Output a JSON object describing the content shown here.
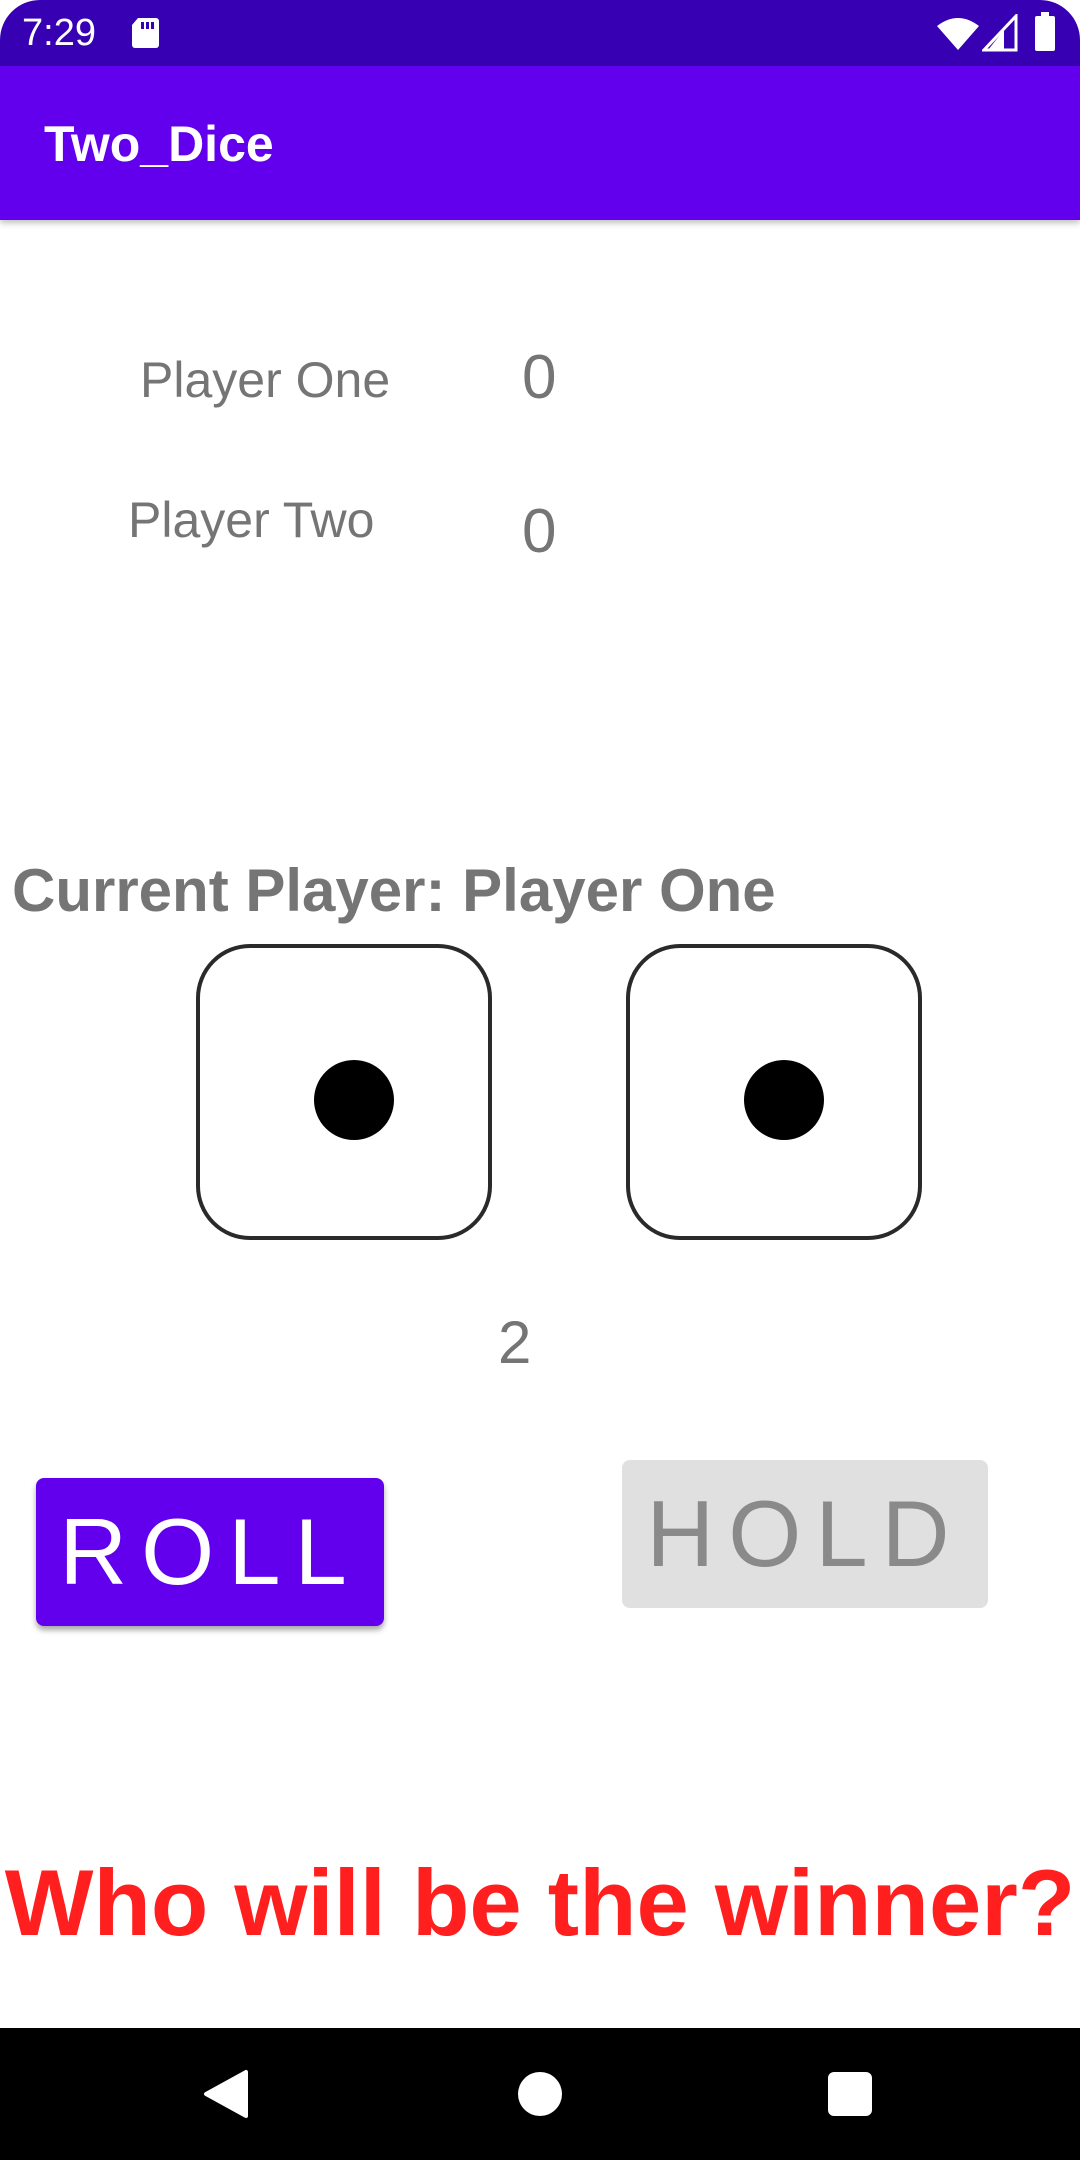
{
  "status_bar": {
    "time": "7:29",
    "icons": [
      "sd-card-icon",
      "wifi-icon",
      "signal-icon",
      "battery-icon"
    ]
  },
  "app_bar": {
    "title": "Two_Dice",
    "color": "#6200ee"
  },
  "scores": {
    "player_one_label": "Player One",
    "player_one_score": "0",
    "player_two_label": "Player Two",
    "player_two_score": "0"
  },
  "current_player": "Current Player: Player One",
  "dice": {
    "die_one_value": 1,
    "die_two_value": 1,
    "total": "2"
  },
  "buttons": {
    "roll_label": "ROLL",
    "hold_label": "HOLD",
    "accent": "#6200ee"
  },
  "winner_message": "Who will be the winner?",
  "winner_color": "#ff1f1f",
  "nav_bar": {
    "icons": [
      "back-icon",
      "home-icon",
      "recents-icon"
    ]
  }
}
